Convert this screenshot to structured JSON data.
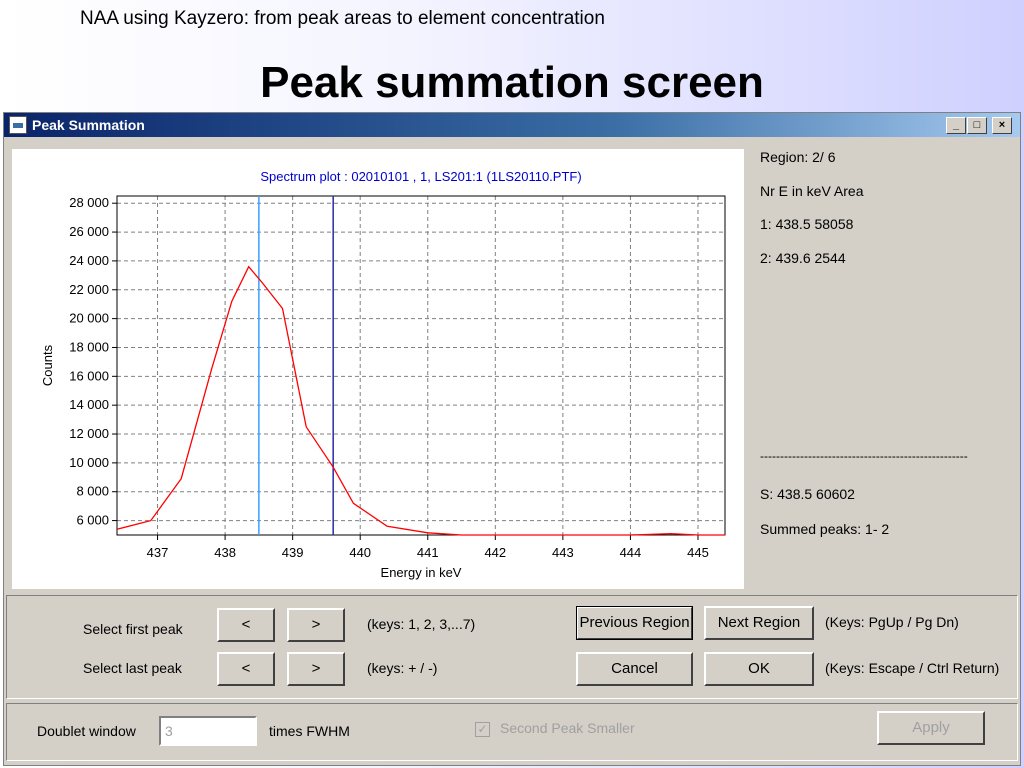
{
  "slide": {
    "subtitle": "NAA using Kayzero: from peak areas to element concentration",
    "title": "Peak summation screen"
  },
  "window": {
    "title": "Peak Summation",
    "controls": {
      "minimize": "_",
      "maximize": "□",
      "close": "×"
    }
  },
  "info": {
    "region": "Region:  2/ 6",
    "header": "Nr E in keV   Area",
    "peaks": [
      "1:  438.5    58058",
      "2:  439.6    2544"
    ],
    "separator": "----------------------------------------------------",
    "sum": "S:  438.5    60602",
    "summed": "Summed peaks:  1- 2"
  },
  "controls": {
    "first_peak_label": "Select first peak",
    "last_peak_label": "Select last peak",
    "prev_label": "<",
    "next_label": ">",
    "first_keys": "(keys: 1, 2, 3,...7)",
    "last_keys": "(keys: + / -)",
    "previous_region": "Previous Region",
    "next_region": "Next Region",
    "region_keys": "(Keys: PgUp / Pg Dn)",
    "cancel": "Cancel",
    "ok": "OK",
    "ok_keys": "(Keys: Escape / Ctrl Return)"
  },
  "bottom": {
    "doublet_label": "Doublet window",
    "doublet_value": "3",
    "fwhm_label": "times FWHM",
    "second_peak_label": "Second Peak Smaller",
    "apply": "Apply"
  },
  "chart_data": {
    "type": "line",
    "title": "Spectrum plot : 02010101 , 1, LS201:1 (1LS20110.PTF)",
    "xlabel": "Energy in keV",
    "ylabel": "Counts",
    "xlim": [
      436.4,
      445.4
    ],
    "ylim": [
      5000,
      28500
    ],
    "xticks": [
      437,
      438,
      439,
      440,
      441,
      442,
      443,
      444,
      445
    ],
    "yticks": [
      6000,
      8000,
      10000,
      12000,
      14000,
      16000,
      18000,
      20000,
      22000,
      24000,
      26000,
      28000
    ],
    "ytick_labels": [
      "6 000",
      "8 000",
      "10 000",
      "12 000",
      "14 000",
      "16 000",
      "18 000",
      "20 000",
      "22 000",
      "24 000",
      "26 000",
      "28 000"
    ],
    "grid": true,
    "series": [
      {
        "color": "#ff0000",
        "x": [
          436.4,
          436.9,
          437.35,
          437.8,
          438.1,
          438.35,
          438.55,
          438.85,
          439.2,
          439.6,
          439.9,
          440.4,
          441.0,
          441.5,
          442.5,
          443.5,
          444.0,
          444.6,
          445.0,
          445.4
        ],
        "y": [
          5400,
          6000,
          8900,
          16500,
          21200,
          23600,
          22500,
          20700,
          12500,
          9700,
          7200,
          5600,
          5150,
          5000,
          5000,
          5000,
          5000,
          5100,
          5000,
          5000
        ]
      }
    ],
    "markers": [
      {
        "x": 438.5,
        "color": "#3aa0ff"
      },
      {
        "x": 439.6,
        "color": "#2a2aa8"
      }
    ],
    "colors": {
      "title": "#0000cc",
      "grid": "#808080"
    }
  }
}
